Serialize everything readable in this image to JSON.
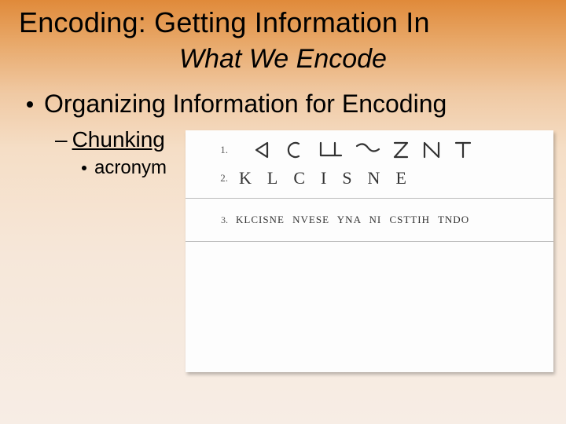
{
  "title": "Encoding: Getting Information In",
  "subtitle": "What We Encode",
  "bullets": {
    "level1": "Organizing Information for Encoding",
    "level2": "Chunking",
    "level3": "acronym"
  },
  "figure": {
    "row1_num": "1.",
    "row2_num": "2.",
    "row2_letters": "KLCISNE",
    "row3_num": "3.",
    "row3_text": "KLCISNE NVESE YNA NI CSTTIH TNDO"
  }
}
